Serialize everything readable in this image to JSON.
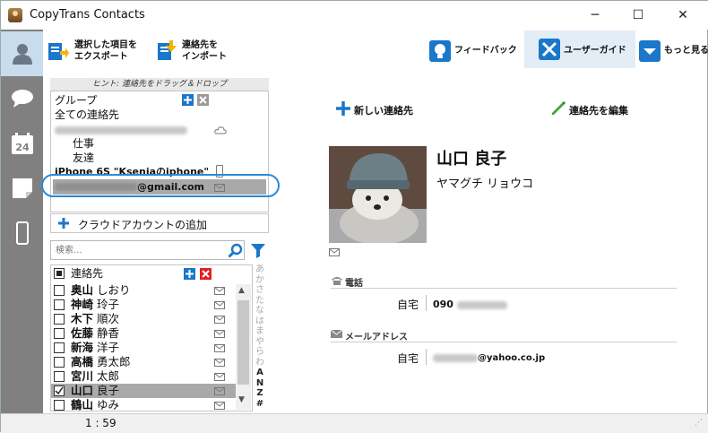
{
  "app": {
    "title": "CopyTrans Contacts"
  },
  "window_controls": {
    "minimize": "─",
    "maximize": "☐",
    "close": "✕"
  },
  "nav": [
    "contacts",
    "messages",
    "calendar",
    "notes",
    "device"
  ],
  "toolbar": {
    "export": "選択した項目を\nエクスポート",
    "import": "連絡先を\nインポート",
    "feedback": "フィードバック",
    "guide": "ユーザーガイド",
    "more": "もっと見る"
  },
  "hint": "ヒント: 連絡先をドラッグ＆ドロップ",
  "groups": {
    "header": "グループ",
    "all": "全ての連絡先",
    "work": "仕事",
    "friends": "友達",
    "iphone": "iPhone 6S \"Kseniaのiphone\"",
    "gmail_suffix": "@gmail.com"
  },
  "add_cloud": "クラウドアカウントの追加",
  "search": {
    "placeholder": "検索..."
  },
  "list": {
    "header": "連絡先",
    "contacts": [
      {
        "last": "奥山",
        "first": "しおり",
        "checked": false,
        "selected": false
      },
      {
        "last": "神崎",
        "first": "玲子",
        "checked": false,
        "selected": false
      },
      {
        "last": "木下",
        "first": "順次",
        "checked": false,
        "selected": false
      },
      {
        "last": "佐藤",
        "first": "静香",
        "checked": false,
        "selected": false
      },
      {
        "last": "新海",
        "first": "洋子",
        "checked": false,
        "selected": false
      },
      {
        "last": "高橋",
        "first": "勇太郎",
        "checked": false,
        "selected": false
      },
      {
        "last": "宮川",
        "first": "太郎",
        "checked": false,
        "selected": false
      },
      {
        "last": "山口",
        "first": "良子",
        "checked": true,
        "selected": true
      },
      {
        "last": "鶴山",
        "first": "ゆみ",
        "checked": false,
        "selected": false
      }
    ]
  },
  "alpha_index": [
    "あ",
    "か",
    "さ",
    "た",
    "な",
    "は",
    "ま",
    "や",
    "ら",
    "わ",
    "A",
    "N",
    "Z",
    "#"
  ],
  "status": {
    "count": "1 : 59"
  },
  "actions": {
    "new_contact": "新しい連絡先",
    "edit_contact": "連絡先を編集"
  },
  "contact": {
    "name": "山口 良子",
    "kana": "ヤマグチ リョウコ",
    "phone_section": "電話",
    "phone_label": "自宅",
    "phone_prefix": "090",
    "email_section": "メールアドレス",
    "email_label": "自宅",
    "email_suffix": "@yahoo.co.jp"
  },
  "colors": {
    "accent": "#1a77c9",
    "highlight_ring": "#2a8ad8",
    "selected_row": "#a9a9a9",
    "nav_bg": "#808080"
  }
}
